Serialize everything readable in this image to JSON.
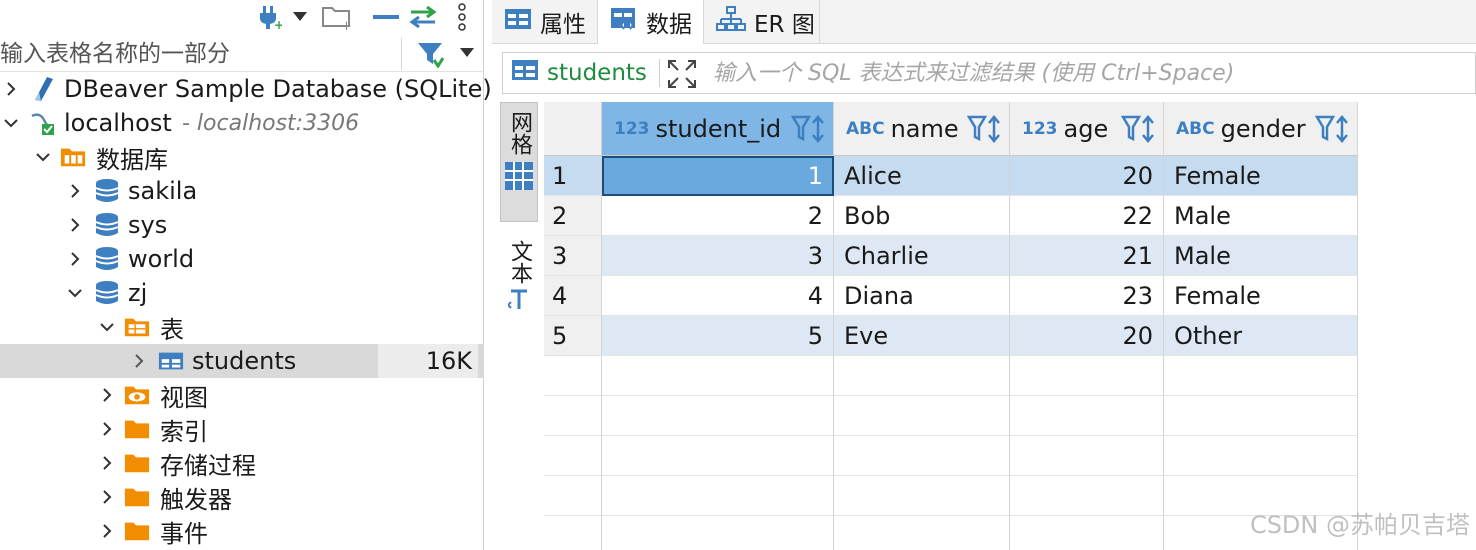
{
  "navigator": {
    "filter_placeholder": "输入表格名称的一部分",
    "tree": [
      {
        "label": "DBeaver Sample Database (SQLite)",
        "icon": "sqlite-icon",
        "expanded": false
      },
      {
        "label": "localhost",
        "note": "- localhost:3306",
        "icon": "mysql-connection-icon",
        "expanded": true
      },
      {
        "label": "数据库",
        "icon": "folder-databases-icon",
        "expanded": true
      },
      {
        "label": "sakila",
        "icon": "database-icon",
        "expanded": false
      },
      {
        "label": "sys",
        "icon": "database-icon",
        "expanded": false
      },
      {
        "label": "world",
        "icon": "database-icon",
        "expanded": false
      },
      {
        "label": "zj",
        "icon": "database-icon",
        "expanded": true
      },
      {
        "label": "表",
        "icon": "folder-tables-icon",
        "expanded": true
      },
      {
        "label": "students",
        "size": "16K",
        "icon": "table-icon",
        "expanded": false,
        "selected": true
      },
      {
        "label": "视图",
        "icon": "folder-views-icon",
        "expanded": false
      },
      {
        "label": "索引",
        "icon": "folder-icon",
        "expanded": false
      },
      {
        "label": "存储过程",
        "icon": "folder-icon",
        "expanded": false
      },
      {
        "label": "触发器",
        "icon": "folder-icon",
        "expanded": false
      },
      {
        "label": "事件",
        "icon": "folder-icon",
        "expanded": false
      }
    ]
  },
  "editor": {
    "tabs": [
      {
        "label": "属性",
        "icon": "properties-icon"
      },
      {
        "label": "数据",
        "icon": "data-icon",
        "active": true
      },
      {
        "label": "ER 图",
        "icon": "er-diagram-icon"
      }
    ],
    "table_name": "students",
    "filter_placeholder": "输入一个 SQL 表达式来过滤结果 (使用 Ctrl+Space)",
    "side_tabs": [
      {
        "label": "网格",
        "active": true
      },
      {
        "label": "文本",
        "active": false
      }
    ],
    "columns": [
      {
        "name": "student_id",
        "type": "123",
        "selected": true
      },
      {
        "name": "name",
        "type": "ABC"
      },
      {
        "name": "age",
        "type": "123"
      },
      {
        "name": "gender",
        "type": "ABC"
      }
    ],
    "rows": [
      {
        "num": "1",
        "student_id": "1",
        "name": "Alice",
        "age": "20",
        "gender": "Female"
      },
      {
        "num": "2",
        "student_id": "2",
        "name": "Bob",
        "age": "22",
        "gender": "Male"
      },
      {
        "num": "3",
        "student_id": "3",
        "name": "Charlie",
        "age": "21",
        "gender": "Male"
      },
      {
        "num": "4",
        "student_id": "4",
        "name": "Diana",
        "age": "23",
        "gender": "Female"
      },
      {
        "num": "5",
        "student_id": "5",
        "name": "Eve",
        "age": "20",
        "gender": "Other"
      }
    ]
  },
  "watermark": "CSDN @苏帕贝吉塔",
  "colors": {
    "accent_blue": "#3e7fc1",
    "folder_orange": "#f28c00",
    "selected_header": "#7fb6e6",
    "table_name_green": "#1e8c3a"
  }
}
